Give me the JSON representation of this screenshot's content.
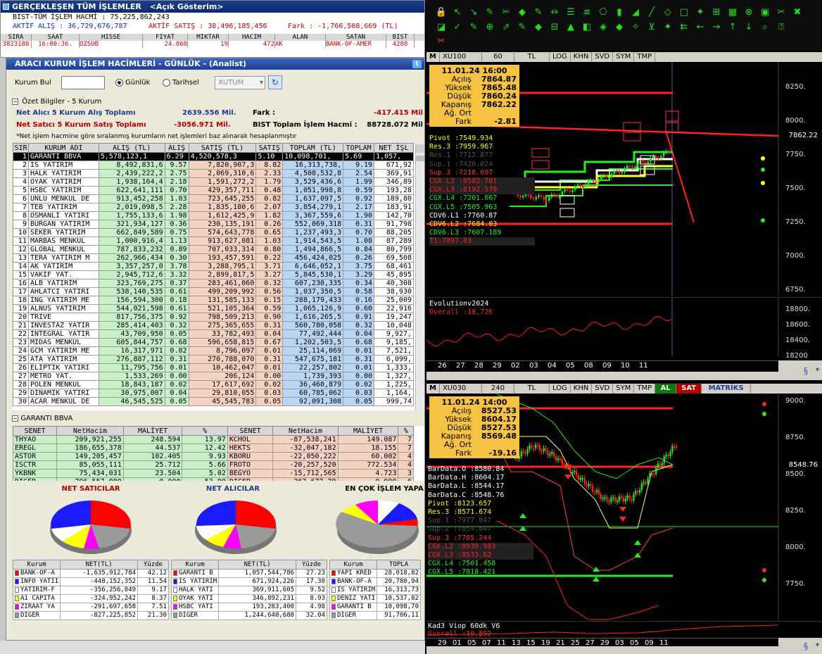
{
  "gerceklesen": {
    "title": "GERÇEKLEŞEN TÜM İŞLEMLER",
    "subtitle": "<Açık Gösterim>",
    "hacim": "BIST-TÜM İŞLEM HACMİ : 75,225,862,243",
    "aktif_alis": "AKTİF ALIŞ : 36,729,676,787",
    "aktif_satis": "AKTİF SATIŞ : 38,496,185,456",
    "fark": "Fark : -1,766,508,669 (TL)",
    "cols": [
      "SIRA",
      "SAAT",
      "HİSSE",
      "FİYAT",
      "MİKTAR",
      "HACİM",
      "ALAN",
      "SATAN",
      "BİST"
    ],
    "row": [
      "3823188",
      "16:00:36.",
      "OZSUB",
      "24.860",
      "19",
      "472",
      "AK",
      "BANK-OF-AMER",
      "4288"
    ]
  },
  "araci": {
    "title": "ARACI KURUM İŞLEM HACİMLERİ - GÜNLÜK - (Analist)",
    "kurum_bul": "Kurum Bul",
    "gunluk": "Günlük",
    "tarihsel": "Tarihsel",
    "select": "XUTUM",
    "ozet": "Özet Bilgiler - 5 Kurum",
    "net_alici_lbl": "Net Alıcı 5 Kurum Alış Toplamı",
    "net_alici_val": "2639.556 Mil.",
    "fark_lbl": "Fark :",
    "fark_val": "-417.415 Mil",
    "net_satici_lbl": "Net Satıcı 5 Kurum Satış Toplamı",
    "net_satici_val": "-3056.971 Mil.",
    "bist_lbl": "BIST Toplam İşlem Hacmi :",
    "bist_val": "88728.072 Mil",
    "note": "*Net işlem hacmine göre sıralanmış kurumların net işlemleri baz alınarak hesaplanmıştır",
    "cols": [
      "SIR",
      "KURUM ADI",
      "ALIŞ (TL)",
      "ALIŞ",
      "SATIŞ (TL)",
      "SATIŞ",
      "TOPLAM (TL)",
      "TOPLAM",
      "NET İŞL"
    ],
    "rows": [
      [
        "1",
        "GARANTI BBVA",
        "5,578,123,1",
        "6.29",
        "4,520,578,3",
        "5.10",
        "10,098,701,",
        "5.69",
        "1,057,"
      ],
      [
        "2",
        "IS YATIRIM",
        "8,492,831,6",
        "9.57",
        "7,820,907,3",
        "8.82",
        "16,313,738,",
        "9.19",
        "671,92"
      ],
      [
        "3",
        "HALK YATIRIM",
        "2,439,222,2",
        "2.75",
        "2,069,310,6",
        "2.33",
        "4,508,532,8",
        "2.54",
        "369,91"
      ],
      [
        "4",
        "OYAK YATIRIM",
        "1,938,164,4",
        "2.18",
        "1,591,272,2",
        "1.79",
        "3,529,436,6",
        "1.99",
        "346,89"
      ],
      [
        "5",
        "HSBC YATIRIM",
        "622,641,111",
        "0.70",
        "429,357,711",
        "0.48",
        "1,051,998,8",
        "0.59",
        "193,28"
      ],
      [
        "6",
        "UNLU MENKUL DE",
        "913,452,258",
        "1.03",
        "723,645,255",
        "0.82",
        "1,637,097,5",
        "0.92",
        "189,80"
      ],
      [
        "7",
        "TEB YATIRIM",
        "2,019,098,5",
        "2.28",
        "1,835,180,6",
        "2.07",
        "3,854,279,1",
        "2.17",
        "183,91"
      ],
      [
        "8",
        "OSMANLI YATIRI",
        "1,755,133,6",
        "1.98",
        "1,612,425,9",
        "1.82",
        "3,367,559,6",
        "1.90",
        "142,70"
      ],
      [
        "9",
        "BURGAN YATIRIM",
        "321,934,127",
        "0.36",
        "230,135,191",
        "0.26",
        "552,069,318",
        "0.31",
        "91,798"
      ],
      [
        "10",
        "SEKER YATIRIM",
        "662,849,589",
        "0.75",
        "574,643,778",
        "0.65",
        "1,237,493,3",
        "0.70",
        "88,205"
      ],
      [
        "11",
        "MARBAS MENKUL",
        "1,000,916,4",
        "1.13",
        "913,627,081",
        "1.03",
        "1,914,543,5",
        "1.08",
        "87,289"
      ],
      [
        "12",
        "GLOBAL MENKUL",
        "787,833,232",
        "0.89",
        "707,033,314",
        "0.80",
        "1,494,866,5",
        "0.84",
        "80,799"
      ],
      [
        "13",
        "TERA YATIRIM M",
        "262,966,434",
        "0.30",
        "193,457,591",
        "0.22",
        "456,424,025",
        "0.26",
        "69,508"
      ],
      [
        "14",
        "AK YATIRIM",
        "3,357,257,0",
        "3.78",
        "3,288,795,1",
        "3.71",
        "6,646,052,1",
        "3.75",
        "68,461"
      ],
      [
        "15",
        "VAKIF YAT.",
        "2,945,712,6",
        "3.32",
        "2,899,817,5",
        "3.27",
        "5,845,530,1",
        "3.29",
        "45,895"
      ],
      [
        "16",
        "ALB YATIRIM",
        "323,769,275",
        "0.37",
        "283,461,060",
        "0.32",
        "607,230,335",
        "0.34",
        "40,308"
      ],
      [
        "17",
        "AHLATCI YATIRI",
        "538,140,535",
        "0.61",
        "499,209,992",
        "0.56",
        "1,037,350,5",
        "0.58",
        "38,930"
      ],
      [
        "18",
        "ING YATIRIM ME",
        "156,594,300",
        "0.18",
        "131,585,133",
        "0.15",
        "288,179,433",
        "0.16",
        "25,009"
      ],
      [
        "19",
        "ALNUS YATIRIM",
        "544,021,598",
        "0.61",
        "521,105,364",
        "0.59",
        "1,065,126,9",
        "0.60",
        "22,916"
      ],
      [
        "20",
        "TRIVE",
        "817,756,375",
        "0.92",
        "798,509,213",
        "0.90",
        "1,616,265,5",
        "0.91",
        "19,247"
      ],
      [
        "21",
        "INVESTAZ YATIR",
        "285,414,403",
        "0.32",
        "275,365,655",
        "0.31",
        "560,780,058",
        "0.32",
        "10,048"
      ],
      [
        "22",
        "INTEGRAL YATIR",
        "43,709,950",
        "0.05",
        "33,782,493",
        "0.04",
        "77,492,444",
        "0.04",
        "9,927,"
      ],
      [
        "23",
        "MIDAS MENKUL",
        "605,844,757",
        "0.68",
        "596,658,815",
        "0.67",
        "1,202,503,5",
        "0.68",
        "9,185,"
      ],
      [
        "24",
        "GCM YATIRIM ME",
        "16,317,971",
        "0.02",
        "8,796,097",
        "0.01",
        "25,114,069",
        "0.01",
        "7,521,"
      ],
      [
        "25",
        "ATA YATIRIM",
        "276,887,112",
        "0.31",
        "270,788,070",
        "0.31",
        "547,675,181",
        "0.31",
        "6,099,"
      ],
      [
        "26",
        "ELIPTIK YATIRI",
        "11,795,756",
        "0.01",
        "10,462,047",
        "0.01",
        "22,257,802",
        "0.01",
        "1,333,"
      ],
      [
        "27",
        "METRO YAT.",
        "1,533,269",
        "0.00",
        "206,124",
        "0.00",
        "1,739,393",
        "0.00",
        "1,327,"
      ],
      [
        "28",
        "POLEN MENKUL",
        "18,843,187",
        "0.02",
        "17,617,692",
        "0.02",
        "36,460,879",
        "0.02",
        "1,225,"
      ],
      [
        "29",
        "DINAMIK YATIRI",
        "30,975,007",
        "0.04",
        "29,810,055",
        "0.03",
        "60,785,062",
        "0.03",
        "1,164,"
      ],
      [
        "30",
        "ACAR MENKUL DE",
        "46,545,525",
        "0.05",
        "45,545,783",
        "0.05",
        "92,091,308",
        "0.05",
        "999,74"
      ]
    ],
    "garanti_title": "GARANTI BBVA",
    "gcols": [
      "SENET",
      "NetHacim",
      "MALİYET",
      "%",
      "SENET",
      "NetHacim",
      "MALİYET",
      "%"
    ],
    "grows": [
      [
        "THYAO",
        "209,921,255",
        "248.594",
        "13.97",
        "KCHOL",
        "-87,538,241",
        "149.087",
        "7"
      ],
      [
        "EREGL",
        "186,655,378",
        "44.537",
        "12.42",
        "HEKTS",
        "-32,047,182",
        "18.155",
        "7"
      ],
      [
        "ASTOR",
        "149,205,457",
        "102.405",
        "9.93",
        "KBORU",
        "-22,050,222",
        "60.002",
        "4"
      ],
      [
        "ISCTR",
        "85,055,111",
        "25.712",
        "5.66",
        "FROTO",
        "-20,257,520",
        "772.534",
        "4"
      ],
      [
        "YKBNK",
        "75,434,031",
        "23.504",
        "5.02",
        "BEGYO",
        "-15,712,565",
        "4.723",
        "3"
      ],
      [
        "DİGER",
        "796,557,080",
        "0.000",
        "53.00",
        "DİGER",
        "-267,677,79",
        "0.000",
        "6"
      ]
    ],
    "pie_titles": [
      "NET SATICILAR",
      "NET ALICILAR",
      "EN ÇOK İŞLEM YAPA"
    ],
    "p1cols": [
      "Kurum",
      "NET(TL)",
      "Yüzde"
    ],
    "p1rows": [
      [
        "BANK-OF-A",
        "-1,635,912,784",
        "42.12"
      ],
      [
        "INFO YATII",
        "-448,152,352",
        "11.54"
      ],
      [
        "YATIRIM-F",
        "-356,256,049",
        "9.17"
      ],
      [
        "A1 CAPITA",
        "-324,952,242",
        "8.37"
      ],
      [
        "ZIRAAT YA",
        "-291,697,658",
        "7.51"
      ],
      [
        "DİGER",
        "-827,225,852",
        "21.30"
      ]
    ],
    "p2cols": [
      "Kurum",
      "NET(TL)",
      "Yüzde"
    ],
    "p2rows": [
      [
        "GARANTI B",
        "1,057,544,786",
        "27.23"
      ],
      [
        "IS YATIRIM",
        "671,924,226",
        "17.30"
      ],
      [
        "HALK YATI",
        "369,911,605",
        "9.52"
      ],
      [
        "OYAK YATI",
        "346,892,231",
        "8.93"
      ],
      [
        "HSBC YATI",
        "193,283,400",
        "4.98"
      ],
      [
        "DİGER",
        "1,244,640,688",
        "32.04"
      ]
    ],
    "p3cols": [
      "Kurum",
      "TOPLA"
    ],
    "p3rows": [
      [
        "YAPI KRED",
        "28,018,82"
      ],
      [
        "BANK-OF-A",
        "20,780,94"
      ],
      [
        "IS YATIRIM",
        "16,313,73"
      ],
      [
        "DENIZ YATI",
        "10,537,82"
      ],
      [
        "GARANTI B",
        "10,098,70"
      ],
      [
        "DİGER",
        "91,706,11"
      ]
    ]
  },
  "chart1": {
    "code": "XU100",
    "period": "60",
    "cur": "TL",
    "tabs": [
      "LOG",
      "KHN",
      "SVD",
      "SYM",
      "TMP"
    ],
    "date": "11.01.24 16:00",
    "info": [
      [
        "Açılış",
        "7864.87"
      ],
      [
        "Yüksek",
        "7865.48"
      ],
      [
        "Düşük",
        "7860.24"
      ],
      [
        "Kapanış",
        "7862.22"
      ],
      [
        "Ağ. Ort",
        ""
      ],
      [
        "Fark",
        "-2.81"
      ]
    ],
    "inds": [
      "Pivot :7549.934",
      "Res.3 :7959.967",
      "Res.1 :7712.877",
      "Sup.1 :7420.024",
      "Sup.3 :7218.697",
      "CGX.L2 :8582.701",
      "CGX.L3 :8192.579",
      "CGX.L4 :7201.667",
      "CGX.L5 :7505.963",
      "CDV6.L1 :7760.87",
      "CDV6.L2 :7684.03",
      "CDV6.L3 :7607.189",
      "T1:7897.83"
    ],
    "yaxis": [
      "8250.",
      "8000.",
      "7750.",
      "7500.",
      "7250.",
      "7000.",
      "6750."
    ],
    "last": "7862.22",
    "ev_title": "Evolutionv2024",
    "ev_sub": "Overall :18,726",
    "ev_y": [
      "18800.",
      "18600.",
      "18400.",
      "18200"
    ],
    "dates": [
      "26",
      "27",
      "28",
      "29",
      "02",
      "03",
      "04",
      "05",
      "08",
      "09",
      "10",
      "11"
    ]
  },
  "chart2": {
    "code": "XU030",
    "period": "240",
    "cur": "TL",
    "tabs": [
      "LOG",
      "KHN",
      "SVD",
      "SYM",
      "TMP"
    ],
    "al": "AL",
    "sat": "SAT",
    "matriks": "MATRİKS",
    "date": "11.01.24 14:00",
    "info": [
      [
        "Açılış",
        "8527.53"
      ],
      [
        "Yüksek",
        "8604.17"
      ],
      [
        "Düşük",
        "8527.53"
      ],
      [
        "Kapanış",
        "8569.48"
      ],
      [
        "Ağ. Ort",
        ""
      ],
      [
        "Fark",
        "-19.16"
      ]
    ],
    "inds": [
      "BarData.O :8580.84",
      "BarData.H :8604.17",
      "BarData.L :8544.17",
      "BarData.C :8548.76",
      "Pivot :8123.657",
      "Res.3 :8571.674",
      "Sup.1 :7977.047",
      "Sup.2 :7854.847",
      "Sup.3 :7765.244",
      "CGX.L2 :8939.983",
      "CGX.L3 :8533.62",
      "CGX.L4 :7501.458",
      "CGX.L5 :7818.421"
    ],
    "yaxis": [
      "9000.",
      "8750.",
      "8500.",
      "8250.",
      "8000.",
      "7750."
    ],
    "last": "8548.76",
    "ind2_title": "Kad3 Viop 60dk V6",
    "ind2_sub": "Overall :10,552",
    "dates": [
      "29",
      "01",
      "05",
      "07",
      "11",
      "13",
      "15",
      "19",
      "21",
      "25",
      "27",
      "29",
      "03",
      "05",
      "09",
      "11"
    ]
  },
  "colors": {
    "red": "#ff0000",
    "green": "#22dd22",
    "yellow": "#ffff00",
    "box": "#f5c242"
  }
}
